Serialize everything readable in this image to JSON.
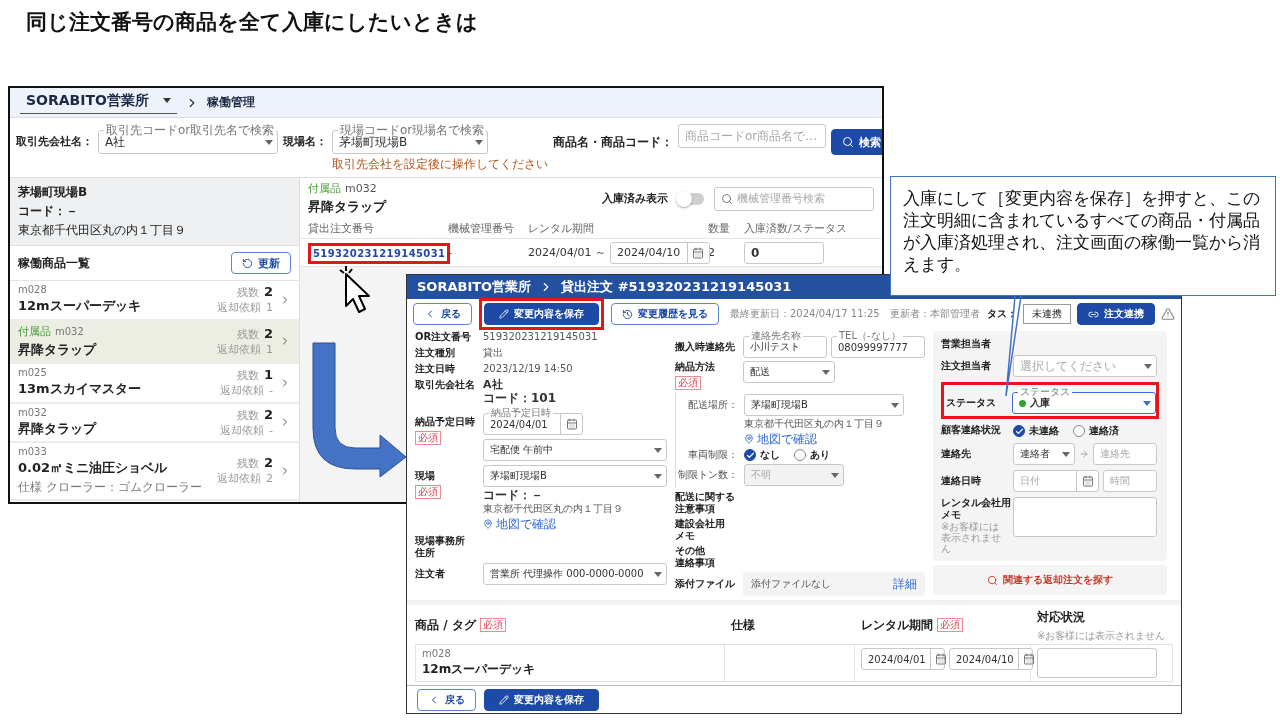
{
  "slide_title": "同じ注文番号の商品を全て入庫にしたいときは",
  "operations_window": {
    "office": "SORABITO営業所",
    "page": "稼働管理",
    "filters": [
      {
        "label": "取引先会社名：",
        "floating_label": "取引先コードor取引先名で検索",
        "value": "A社"
      },
      {
        "label": "現場名：",
        "floating_label": "現場コードor現場名で検索",
        "value": "茅場町現場B",
        "hint": "取引先会社を設定後に操作してください"
      },
      {
        "label": "商品名・商品コード：",
        "placeholder": "商品コードor商品名で…"
      }
    ],
    "search_button": "検索",
    "site": {
      "name": "茅場町現場B",
      "code": "コード：－",
      "address": "東京都千代田区丸の内１丁目９"
    },
    "list_title": "稼働商品一覧",
    "refresh_button": "更新",
    "items": [
      {
        "code": "m028",
        "name": "12mスーパーデッキ",
        "remain_label": "残数",
        "remain": "2",
        "return_label": "返却依頼",
        "return": "1",
        "selected": false
      },
      {
        "tag": "付属品",
        "code": "m032",
        "name": "昇降タラップ",
        "remain_label": "残数",
        "remain": "2",
        "return_label": "返却依頼",
        "return": "1",
        "selected": true
      },
      {
        "code": "m025",
        "name": "13mスカイマスター",
        "remain_label": "残数",
        "remain": "1",
        "return_label": "返却依頼",
        "return": "-",
        "selected": false
      },
      {
        "code": "m032",
        "name": "昇降タラップ",
        "remain_label": "残数",
        "remain": "2",
        "return_label": "返却依頼",
        "return": "-",
        "selected": false
      },
      {
        "code": "m033",
        "name": "0.02㎥ミニ油圧ショベル",
        "spec": "仕様 クローラー：ゴムクローラー",
        "remain_label": "残数",
        "remain": "2",
        "return_label": "返却依頼",
        "return": "2",
        "selected": false
      }
    ],
    "detail": {
      "tag": "付属品",
      "code": "m032",
      "name": "昇降タラップ",
      "toggle_label": "入庫済み表示",
      "toggle_on": false,
      "search_placeholder": "機械管理番号検索",
      "columns": [
        "貸出注文番号",
        "機械管理番号",
        "レンタル期間",
        "数量",
        "入庫済数/ステータス"
      ],
      "rows": [
        {
          "order_no": "519320231219145031",
          "highlighted": true,
          "machine_no": "-",
          "start": "2024/04/01 ～",
          "end": "2024/04/10",
          "quantity": "2",
          "received": "0"
        }
      ]
    }
  },
  "order_window": {
    "office": "SORABITO営業所",
    "title": "貸出注文 #519320231219145031",
    "toolbar": {
      "back": "戻る",
      "save": {
        "label": "変更内容を保存",
        "highlighted": true
      },
      "history": "変更履歴を見る",
      "meta": "最終更新日：2024/04/17 11:25　更新者：本部管理者",
      "link_status_label": "タス：",
      "link_status": "未連携",
      "link_button": "注文連携"
    },
    "left_fields": [
      {
        "kind": "text",
        "label": "OR注文番号",
        "value": "519320231219145031"
      },
      {
        "kind": "text",
        "label": "注文種別",
        "value": "貸出"
      },
      {
        "kind": "text",
        "label": "注文日時",
        "value": "2023/12/19 14:50"
      },
      {
        "kind": "company",
        "label": "取引先会社名",
        "value": "A社",
        "code": "コード：101"
      },
      {
        "kind": "delivery",
        "label": "納品予定日時",
        "required": "必須",
        "floating_label": "納品予定日時",
        "date": "2024/04/01",
        "time": "宅配便 午前中"
      },
      {
        "kind": "site",
        "label": "現場",
        "required": "必須",
        "value": "茅場町現場B",
        "code": "コード：－",
        "address": "東京都千代田区丸の内１丁目９",
        "map_link": "地図で確認"
      },
      {
        "kind": "empty",
        "label_lines": [
          "現場事務所",
          "住所"
        ]
      },
      {
        "kind": "select",
        "label": "注文者",
        "value": "営業所 代理操作 000-0000-0000"
      }
    ],
    "middle_fields": [
      {
        "kind": "contact",
        "label": "搬入時連絡先",
        "name_label": "連絡先名称",
        "name": "小川テスト",
        "tel_label": "TEL（-なし）",
        "tel": "08099997777"
      },
      {
        "kind": "delivery_method",
        "label": "納品方法",
        "required": "必須",
        "value": "配送",
        "place_label": "配送場所：",
        "place": "茅場町現場B",
        "address": "東京都千代田区丸の内１丁目９",
        "map_link": "地図で確認",
        "vehicle_label": "車両制限：",
        "vehicle_options": [
          {
            "label": "なし",
            "selected": true
          },
          {
            "label": "あり",
            "selected": false
          }
        ],
        "tonnage_label": "制限トン数：",
        "tonnage": "不明",
        "tonnage_disabled": true
      },
      {
        "kind": "empty",
        "label_lines": [
          "配送に関する",
          "注意事項"
        ]
      },
      {
        "kind": "empty",
        "label_lines": [
          "建設会社用",
          "メモ"
        ]
      },
      {
        "kind": "empty",
        "label_lines": [
          "その他",
          "連絡事項"
        ]
      },
      {
        "kind": "attachment",
        "label": "添付ファイル",
        "value": "添付ファイルなし",
        "link": "詳細"
      }
    ],
    "right_fields": [
      {
        "kind": "empty",
        "label": "営業担当者"
      },
      {
        "kind": "select",
        "label": "注文担当者",
        "placeholder": "選択してください"
      },
      {
        "kind": "status",
        "label": "ステータス",
        "floating_label": "ステータス",
        "value": "入庫",
        "highlighted": true
      },
      {
        "kind": "radio",
        "label": "顧客連絡状況",
        "options": [
          {
            "label": "未連絡",
            "selected": true
          },
          {
            "label": "連絡済",
            "selected": false
          }
        ]
      },
      {
        "kind": "contact_to",
        "label": "連絡先",
        "value": "連絡者",
        "placeholder": "連絡先"
      },
      {
        "kind": "datetime",
        "label": "連絡日時",
        "date_placeholder": "日付",
        "time_placeholder": "時間"
      },
      {
        "kind": "memo",
        "label_lines": [
          "レンタル会社用",
          "メモ"
        ],
        "note": "※お客様には表示されません"
      }
    ],
    "related_button": "関連する返却注文を探す",
    "items_table": {
      "columns": [
        {
          "label": "商品 / タグ",
          "required": "必須"
        },
        {
          "label": "仕様"
        },
        {
          "label": "レンタル期間",
          "required": "必須"
        },
        {
          "label": "対応状況",
          "note": "※お客様には表示されません"
        }
      ],
      "rows": [
        {
          "code": "m028",
          "name": "12mスーパーデッキ",
          "start": "2024/04/01",
          "end": "2024/04/10"
        }
      ]
    },
    "footer": {
      "back": "戻る",
      "save": "変更内容を保存"
    }
  },
  "callout": "入庫にして［変更内容を保存］を押すと、この注文明細に含まれているすべての商品・付属品が入庫済処理され、注文画面の稼働一覧から消えます。"
}
